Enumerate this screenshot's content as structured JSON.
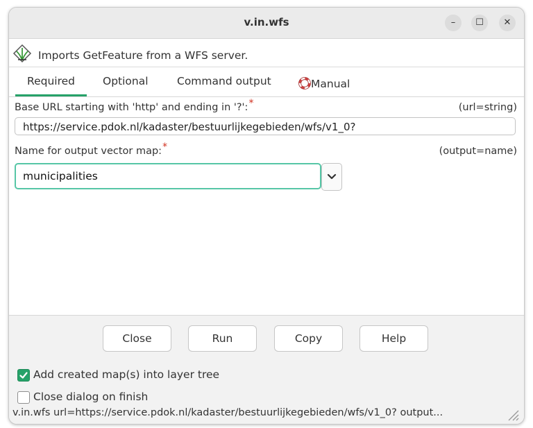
{
  "window": {
    "title": "v.in.wfs"
  },
  "titlebar_buttons": {
    "minimize": "–",
    "maximize": "☐",
    "close": "✕"
  },
  "module": {
    "description": "Imports GetFeature from a WFS server."
  },
  "tabs": [
    {
      "label": "Required",
      "active": true
    },
    {
      "label": "Optional",
      "active": false
    },
    {
      "label": "Command output",
      "active": false
    },
    {
      "label": "Manual",
      "active": false,
      "icon": "lifebuoy-icon"
    }
  ],
  "fields": {
    "url": {
      "label": "Base URL starting with 'http' and ending in '?':",
      "required_mark": "*",
      "hint": "(url=string)",
      "value": "https://service.pdok.nl/kadaster/bestuurlijkegebieden/wfs/v1_0?"
    },
    "output": {
      "label": "Name for output vector map:",
      "required_mark": "*",
      "hint": "(output=name)",
      "value": "municipalities"
    }
  },
  "buttons": {
    "close": "Close",
    "run": "Run",
    "copy": "Copy",
    "help": "Help"
  },
  "options": {
    "add_to_layer_tree": {
      "label": "Add created map(s) into layer tree",
      "checked": true
    },
    "close_on_finish": {
      "label": "Close dialog on finish",
      "checked": false
    }
  },
  "statusbar": {
    "command": "v.in.wfs url=https://service.pdok.nl/kadaster/bestuurlijkegebieden/wfs/v1_0? output..."
  },
  "colors": {
    "accent": "#26a269",
    "focus_border": "#56c6a6",
    "required": "#d0301f"
  }
}
